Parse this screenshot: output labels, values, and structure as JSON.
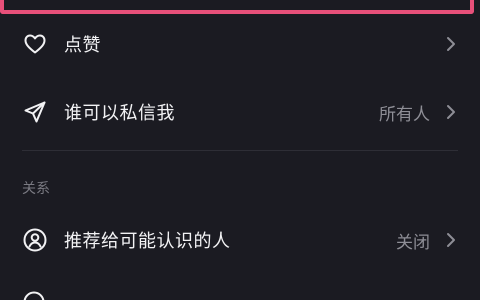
{
  "settings": {
    "rows": [
      {
        "label": "点赞",
        "value": "",
        "icon": "heart-icon"
      },
      {
        "label": "谁可以私信我",
        "value": "所有人",
        "icon": "paper-plane-icon"
      }
    ],
    "section_title": "关系",
    "relation_rows": [
      {
        "label": "推荐给可能认识的人",
        "value": "关闭",
        "icon": "person-circle-icon"
      }
    ]
  },
  "colors": {
    "background": "#1b1b22",
    "highlight": "#e8507a",
    "text": "#f2f2f4",
    "muted": "#8e8e96"
  }
}
